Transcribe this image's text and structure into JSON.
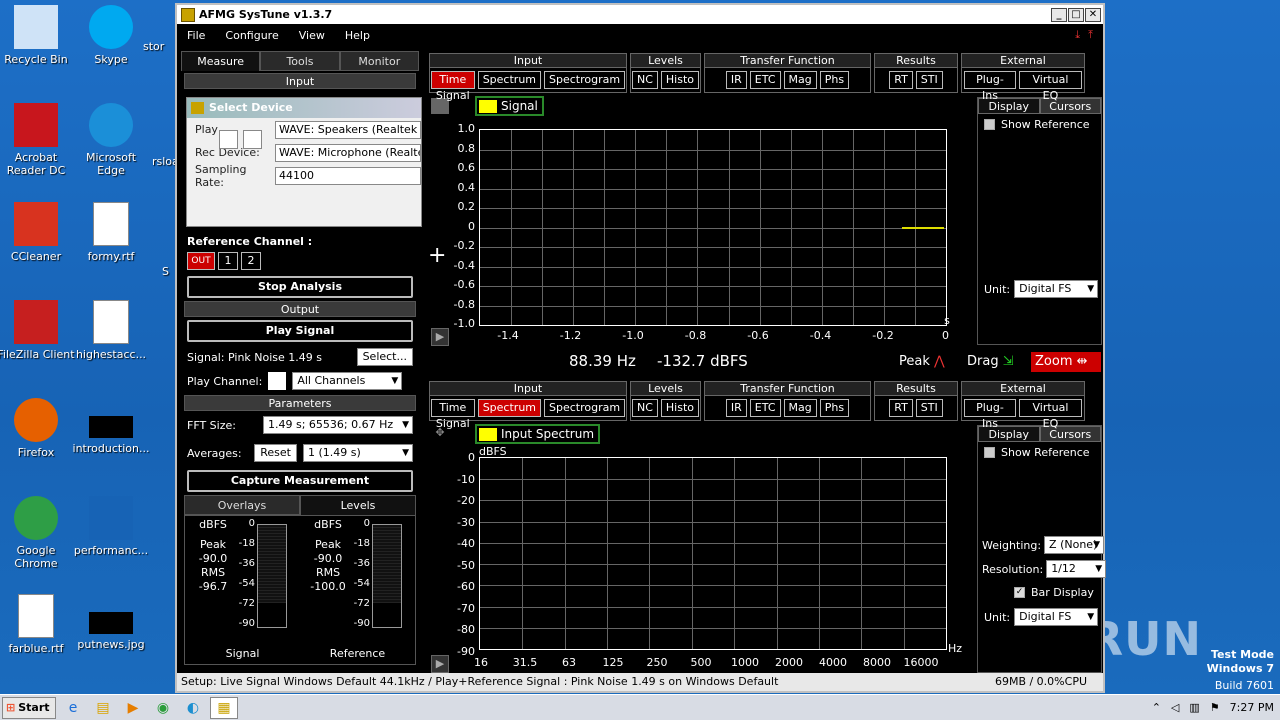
{
  "desktop": {
    "icons_col1": [
      {
        "label": "Recycle Bin",
        "icon": "recycle-bin-icon"
      },
      {
        "label": "Acrobat Reader DC",
        "icon": "acrobat-icon"
      },
      {
        "label": "CCleaner",
        "icon": "ccleaner-icon"
      },
      {
        "label": "FileZilla Client",
        "icon": "filezilla-icon"
      },
      {
        "label": "Firefox",
        "icon": "firefox-icon"
      },
      {
        "label": "Google Chrome",
        "icon": "chrome-icon"
      },
      {
        "label": "farblue.rtf",
        "icon": "word-doc-icon"
      }
    ],
    "icons_col2": [
      {
        "label": "Skype",
        "icon": "skype-icon"
      },
      {
        "label": "Microsoft Edge",
        "icon": "edge-icon"
      },
      {
        "label": "formy.rtf",
        "icon": "word-doc-icon"
      },
      {
        "label": "highestacc...",
        "icon": "word-doc-icon"
      },
      {
        "label": "introduction...",
        "icon": "black-file-icon"
      },
      {
        "label": "performanc...",
        "icon": "blank-file-icon"
      },
      {
        "label": "putnews.jpg",
        "icon": "black-file-icon"
      }
    ],
    "partial_labels": [
      "stor",
      "rsloa",
      "S"
    ],
    "watermark": "ANY RUN",
    "test_mode": [
      "Test Mode",
      "Windows 7",
      "Build 7601"
    ]
  },
  "app": {
    "title": "AFMG SysTune v1.3.7",
    "menu": [
      "File",
      "Configure",
      "View",
      "Help"
    ],
    "left": {
      "tabs": [
        "Measure",
        "Tools",
        "Monitor"
      ],
      "input_header": "Input",
      "reference_channel_label": "Reference Channel :",
      "ref_buttons": [
        "OUT",
        "1",
        "2"
      ],
      "stop_analysis": "Stop Analysis",
      "output_header": "Output",
      "play_signal": "Play Signal",
      "signal_label": "Signal: Pink Noise  1.49 s",
      "select_button": "Select...",
      "play_channel_label": "Play Channel:",
      "play_channel_value": "All Channels",
      "parameters_header": "Parameters",
      "fft_label": "FFT Size:",
      "fft_value": "1.49 s; 65536; 0.67 Hz",
      "averages_label": "Averages:",
      "reset_button": "Reset",
      "averages_value": "1 (1.49 s)",
      "capture_measurement": "Capture Measurement",
      "bottom_tabs": [
        "Overlays",
        "Levels"
      ],
      "meters": [
        {
          "unit": "dBFS",
          "peak_label": "Peak",
          "peak": "-90.0",
          "rms_label": "RMS",
          "rms": "-96.7",
          "name": "Signal"
        },
        {
          "unit": "dBFS",
          "peak_label": "Peak",
          "peak": "-90.0",
          "rms_label": "RMS",
          "rms": "-100.0",
          "name": "Reference"
        }
      ],
      "meter_scale": [
        "0",
        "-18",
        "-36",
        "-54",
        "-72",
        "-90"
      ]
    },
    "dialog": {
      "title": "Select Device",
      "play_label": "Play",
      "play_value": "WAVE: Speakers (Realtek AC",
      "rec_label": "Rec Device:",
      "rec_value": "WAVE: Microphone (Realtek A",
      "rate_label": "Sampling Rate:",
      "rate_value": "44100"
    },
    "toolbar_groups": [
      {
        "title": "Input",
        "buttons": [
          "Time Signal",
          "Spectrum",
          "Spectrogram"
        ]
      },
      {
        "title": "Levels",
        "buttons": [
          "NC",
          "Histo"
        ]
      },
      {
        "title": "Transfer Function",
        "buttons": [
          "IR",
          "ETC",
          "Mag",
          "Phs"
        ]
      },
      {
        "title": "Results",
        "buttons": [
          "RT",
          "STI"
        ]
      },
      {
        "title": "External",
        "buttons": [
          "Plug-Ins",
          "Virtual EQ"
        ]
      }
    ],
    "top_graph": {
      "legend": "Signal",
      "y_ticks": [
        "1.0",
        "0.8",
        "0.6",
        "0.4",
        "0.2",
        "0",
        "-0.2",
        "-0.4",
        "-0.6",
        "-0.8",
        "-1.0"
      ],
      "x_ticks": [
        "-1.4",
        "-1.2",
        "-1.0",
        "-0.8",
        "-0.6",
        "-0.4",
        "-0.2",
        "0"
      ],
      "x_unit": "s",
      "side_tabs": [
        "Display",
        "Cursors"
      ],
      "show_reference": "Show Reference",
      "unit_label": "Unit:",
      "unit_value": "Digital FS"
    },
    "readout": {
      "freq": "88.39 Hz",
      "level": "-132.7 dBFS",
      "peak": "Peak",
      "drag": "Drag",
      "zoom": "Zoom"
    },
    "bottom_graph": {
      "legend": "Input Spectrum",
      "y_unit": "dBFS",
      "y_ticks": [
        "0",
        "-10",
        "-20",
        "-30",
        "-40",
        "-50",
        "-60",
        "-70",
        "-80",
        "-90"
      ],
      "x_ticks": [
        "16",
        "31.5",
        "63",
        "125",
        "250",
        "500",
        "1000",
        "2000",
        "4000",
        "8000",
        "16000"
      ],
      "x_unit": "Hz",
      "side_tabs": [
        "Display",
        "Cursors"
      ],
      "show_reference": "Show Reference",
      "weighting_label": "Weighting:",
      "weighting_value": "Z (None)",
      "resolution_label": "Resolution:",
      "resolution_value": "1/12",
      "bar_display": "Bar Display",
      "unit_label": "Unit:",
      "unit_value": "Digital FS"
    },
    "status_left": "Setup: Live Signal Windows Default 44.1kHz / Play+Reference Signal : Pink Noise  1.49 s on Windows Default",
    "status_right": "69MB / 0.0%CPU"
  },
  "taskbar": {
    "start": "Start",
    "clock": "7:27 PM"
  }
}
